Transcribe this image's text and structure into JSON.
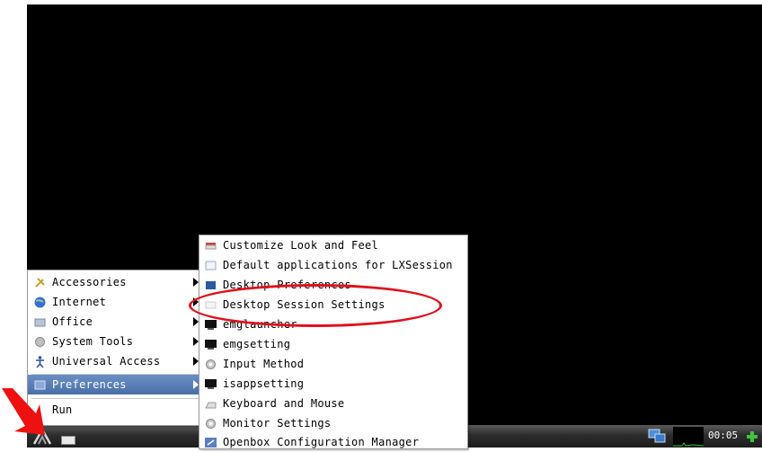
{
  "main_menu": {
    "items": [
      {
        "label": "Accessories",
        "icon": "accessories-icon"
      },
      {
        "label": "Internet",
        "icon": "globe-icon"
      },
      {
        "label": "Office",
        "icon": "office-icon"
      },
      {
        "label": "System Tools",
        "icon": "system-tools-icon"
      },
      {
        "label": "Universal Access",
        "icon": "accessibility-icon"
      },
      {
        "label": "Preferences",
        "icon": "preferences-icon"
      },
      {
        "label": "Run",
        "icon": ""
      }
    ]
  },
  "preferences_submenu": {
    "items": [
      {
        "label": "Customize Look and Feel"
      },
      {
        "label": "Default applications for LXSession"
      },
      {
        "label": "Desktop Preferences"
      },
      {
        "label": "Desktop Session Settings"
      },
      {
        "label": "emglauncher"
      },
      {
        "label": "emgsetting"
      },
      {
        "label": "Input Method"
      },
      {
        "label": "isappsetting"
      },
      {
        "label": "Keyboard and Mouse"
      },
      {
        "label": "Monitor Settings"
      },
      {
        "label": "Openbox Configuration Manager"
      }
    ]
  },
  "taskbar": {
    "clock": "00:05"
  },
  "colors": {
    "highlight": "#4a6fa8",
    "annotation": "#e0101c",
    "desktop": "#000000"
  }
}
